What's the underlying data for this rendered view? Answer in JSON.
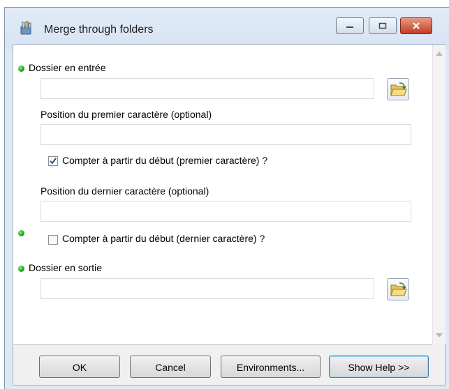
{
  "window": {
    "title": "Merge through folders"
  },
  "fields": {
    "input_folder": {
      "label": "Dossier en entrée",
      "value": ""
    },
    "first_char": {
      "label": "Position du premier caractère (optional)",
      "value": ""
    },
    "count_first": {
      "label": "Compter à partir du début (premier caractère) ?",
      "checked": true
    },
    "last_char": {
      "label": "Position du dernier caractère (optional)",
      "value": ""
    },
    "count_last": {
      "label": "Compter à partir du début (dernier caractère) ?",
      "checked": false
    },
    "output_folder": {
      "label": "Dossier en sortie",
      "value": ""
    }
  },
  "buttons": {
    "ok": "OK",
    "cancel": "Cancel",
    "environments": "Environments...",
    "show_help": "Show Help >>"
  },
  "icons": [
    "toolbox-icon",
    "minimize-icon",
    "maximize-icon",
    "close-icon",
    "folder-open-icon",
    "required-dot-icon",
    "checkbox-icon"
  ]
}
